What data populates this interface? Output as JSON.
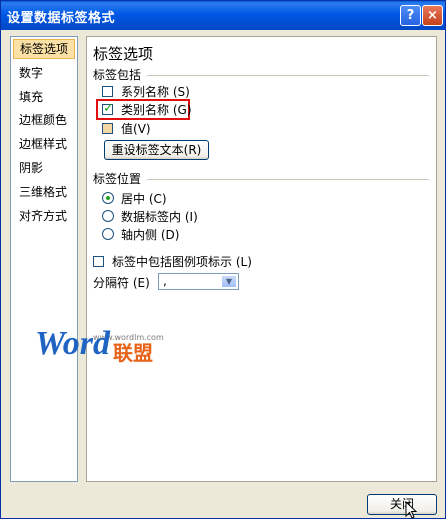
{
  "window": {
    "title": "设置数据标签格式",
    "help_label": "?",
    "close_label": "×"
  },
  "nav": {
    "items": [
      {
        "label": "标签选项",
        "selected": true
      },
      {
        "label": "数字"
      },
      {
        "label": "填充"
      },
      {
        "label": "边框颜色"
      },
      {
        "label": "边框样式"
      },
      {
        "label": "阴影"
      },
      {
        "label": "三维格式"
      },
      {
        "label": "对齐方式"
      }
    ]
  },
  "panel": {
    "heading": "标签选项",
    "contains": {
      "label": "标签包括",
      "series_name": {
        "label": "系列名称",
        "shortcut": "(S)",
        "checked": false
      },
      "category_name": {
        "label": "类别名称",
        "shortcut": "(G)",
        "checked": true
      },
      "value": {
        "label": "值",
        "shortcut": "(V)",
        "state": "partial"
      },
      "reset_button": "重设标签文本(R)"
    },
    "position": {
      "label": "标签位置",
      "options": [
        {
          "label": "居中",
          "shortcut": "(C)",
          "selected": true
        },
        {
          "label": "数据标签内",
          "shortcut": "(I)",
          "selected": false
        },
        {
          "label": "轴内侧",
          "shortcut": "(D)",
          "selected": false
        }
      ]
    },
    "legend_key": {
      "label": "标签中包括图例项标示",
      "shortcut": "(L)",
      "checked": false
    },
    "separator": {
      "label": "分隔符",
      "shortcut": "(E)",
      "value": ","
    }
  },
  "watermark": {
    "url": "www.wordlm.com",
    "word": "Word",
    "cn": "联盟"
  },
  "footer": {
    "close_button": "关闭"
  }
}
